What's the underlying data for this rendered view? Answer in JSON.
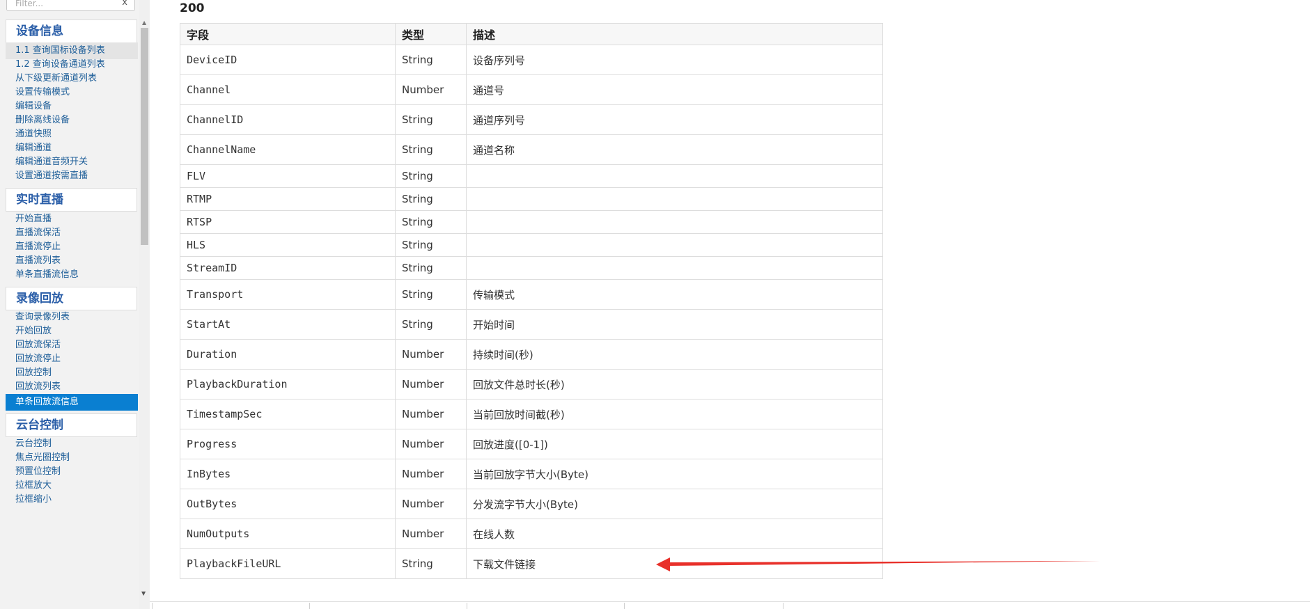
{
  "sidebar": {
    "filter_placeholder": "Filter...",
    "filter_clear": "x",
    "groups": [
      {
        "title": "设备信息"
      },
      {
        "title": "实时直播"
      },
      {
        "title": "录像回放"
      },
      {
        "title": "云台控制"
      }
    ],
    "device_items": [
      "1.1 查询国标设备列表",
      "1.2 查询设备通道列表",
      "从下级更新通道列表",
      "设置传输模式",
      "编辑设备",
      "删除离线设备",
      "通道快照",
      "编辑通道",
      "编辑通道音频开关",
      "设置通道按需直播"
    ],
    "live_items": [
      "开始直播",
      "直播流保活",
      "直播流停止",
      "直播流列表",
      "单条直播流信息"
    ],
    "playback_items": [
      "查询录像列表",
      "开始回放",
      "回放流保活",
      "回放流停止",
      "回放控制",
      "回放流列表",
      "单条回放流信息"
    ],
    "ptz_items": [
      "云台控制",
      "焦点光圈控制",
      "预置位控制",
      "拉框放大",
      "拉框缩小"
    ]
  },
  "main": {
    "status_code": "200",
    "table": {
      "headers": [
        "字段",
        "类型",
        "描述"
      ],
      "rows": [
        {
          "field": "DeviceID",
          "type": "String",
          "desc": "设备序列号"
        },
        {
          "field": "Channel",
          "type": "Number",
          "desc": "通道号"
        },
        {
          "field": "ChannelID",
          "type": "String",
          "desc": "通道序列号"
        },
        {
          "field": "ChannelName",
          "type": "String",
          "desc": "通道名称"
        },
        {
          "field": "FLV",
          "type": "String",
          "desc": ""
        },
        {
          "field": "RTMP",
          "type": "String",
          "desc": ""
        },
        {
          "field": "RTSP",
          "type": "String",
          "desc": ""
        },
        {
          "field": "HLS",
          "type": "String",
          "desc": ""
        },
        {
          "field": "StreamID",
          "type": "String",
          "desc": ""
        },
        {
          "field": "Transport",
          "type": "String",
          "desc": "传输模式"
        },
        {
          "field": "StartAt",
          "type": "String",
          "desc": "开始时间"
        },
        {
          "field": "Duration",
          "type": "Number",
          "desc": "持续时间(秒)"
        },
        {
          "field": "PlaybackDuration",
          "type": "Number",
          "desc": "回放文件总时长(秒)"
        },
        {
          "field": "TimestampSec",
          "type": "Number",
          "desc": "当前回放时间截(秒)"
        },
        {
          "field": "Progress",
          "type": "Number",
          "desc": "回放进度([0-1])"
        },
        {
          "field": "InBytes",
          "type": "Number",
          "desc": "当前回放字节大小(Byte)"
        },
        {
          "field": "OutBytes",
          "type": "Number",
          "desc": "分发流字节大小(Byte)"
        },
        {
          "field": "NumOutputs",
          "type": "Number",
          "desc": "在线人数"
        },
        {
          "field": "PlaybackFileURL",
          "type": "String",
          "desc": "下载文件链接"
        }
      ]
    }
  },
  "colors": {
    "link": "#1f5f99",
    "group_title": "#2a5ea8",
    "active_bg": "#0a7fd1",
    "arrow": "#e8302a"
  }
}
